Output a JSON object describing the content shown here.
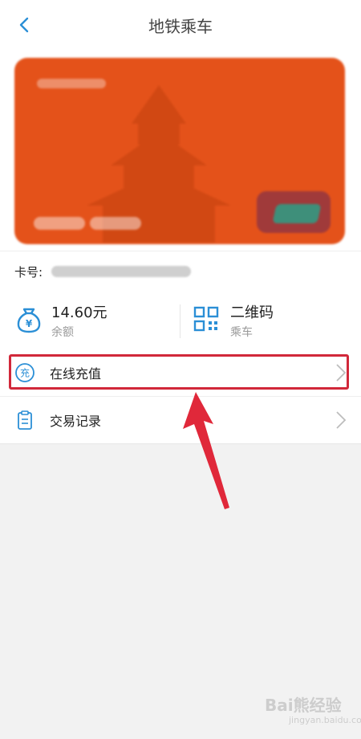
{
  "header": {
    "title": "地铁乘车"
  },
  "card": {
    "number_label": "卡号:"
  },
  "balance": {
    "value": "14.60元",
    "label": "余额"
  },
  "qrcode": {
    "value": "二维码",
    "label": "乘车"
  },
  "menu": [
    {
      "label": "在线充值",
      "icon_char": "充"
    },
    {
      "label": "交易记录"
    }
  ],
  "watermark": {
    "main": "Bai熊经验",
    "sub": "jingyan.baidu.com"
  },
  "colors": {
    "accent": "#2b8fd6",
    "card": "#e4521a",
    "highlight": "#d1283a"
  }
}
